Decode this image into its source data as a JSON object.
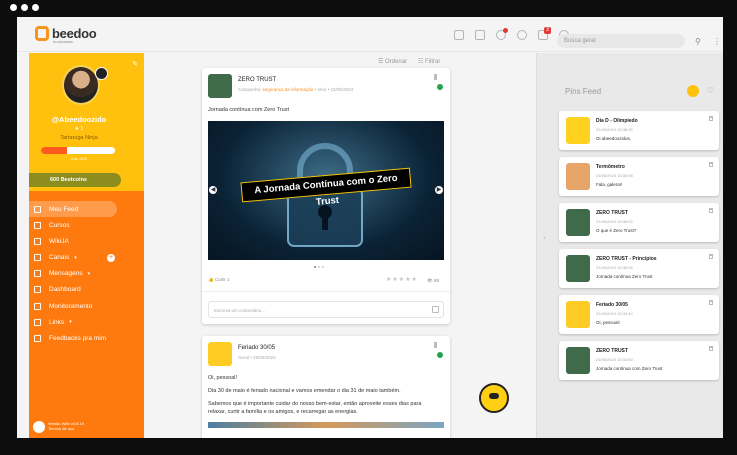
{
  "brand": {
    "name": "beedoo",
    "sub": "PLATAFORMA"
  },
  "topbar": {
    "search_placeholder": "Busca geral",
    "notifications_count": "3"
  },
  "profile": {
    "username": "@Abeedoozido",
    "level": "★ 1",
    "rank": "Tartaruga Ninja",
    "xp_fraction": 0.35,
    "xp_label": "0 de 1000",
    "coins": "600 Beetcoins"
  },
  "nav": [
    {
      "label": "Meu Feed",
      "icon": "feed-icon",
      "active": true
    },
    {
      "label": "Cursos",
      "icon": "courses-icon"
    },
    {
      "label": "WikiJA",
      "icon": "wiki-icon"
    },
    {
      "label": "Canais",
      "icon": "channels-icon",
      "caret": "▾",
      "plus": "+"
    },
    {
      "label": "Mensagens",
      "icon": "messages-icon",
      "caret": "▾"
    },
    {
      "label": "Dashboard",
      "icon": "dashboard-icon"
    },
    {
      "label": "Monitoramento",
      "icon": "monitor-icon"
    },
    {
      "label": "Links",
      "icon": "links-icon",
      "caret": "▾"
    },
    {
      "label": "Feedbacks pra mim",
      "icon": "feedback-icon"
    }
  ],
  "sidebar_footer": {
    "line1": "Versão Web v4.8.19",
    "line2": "Termos de uso"
  },
  "feed_actions": {
    "order": "Ordenar",
    "filter": "Filtrar"
  },
  "posts": [
    {
      "title": "ZERO TRUST",
      "meta_prefix": "Campanha:",
      "meta_channel": "segurança da informação",
      "meta_suffix": " • Vitor • 22/05/2024",
      "text": "Jornada contínua com Zero Trust",
      "banner_text": "A Jornada Contínua com o Zero Trust",
      "reactions": "Curtir 1",
      "stars": "★★★★★",
      "views": "89",
      "comment_placeholder": "Escreva um comentário..."
    },
    {
      "title": "Feriado 30/05",
      "meta": "Geral • 29/05/2024",
      "lines": [
        "Oi, pessoal!",
        "Dia 30 de maio é feriado nacional e vamos emendar o dia 31 de maio também.",
        "Sabemos que é importante cuidar do nosso bem-estar, então aproveite esses dias para",
        "relaxar, curtir a família e os amigos, e recarregar as energias."
      ]
    }
  ],
  "pins": {
    "title": "Pins Feed",
    "items": [
      {
        "title": "Dia D - Olimpíedo",
        "date": "21/06/2024 15:38:35",
        "body": "Oi abeedoozidos,",
        "thumb_color": "#ffd21f"
      },
      {
        "title": "Termômetro",
        "date": "21/06/2024 15:38:08",
        "body": "Fala, galera!!",
        "thumb_color": "#e7a56a"
      },
      {
        "title": "ZERO TRUST",
        "date": "21/06/2024 15:36:52",
        "body": "O que é Zero Trust?",
        "thumb_color": "#3f6b4a"
      },
      {
        "title": "ZERO TRUST - Princípios",
        "date": "21/06/2024 15:36:06",
        "body": "Jornada contínua Zero Trust",
        "thumb_color": "#3f6b4a"
      },
      {
        "title": "Feriado 30/05",
        "date": "21/06/2024 15:34:40",
        "body": "Oi, pessoal!",
        "thumb_color": "#ffcc26"
      },
      {
        "title": "ZERO TRUST",
        "date": "21/06/2024 15:33:50",
        "body": "Jornada contínua com Zero Trust",
        "thumb_color": "#3f6b4a"
      }
    ]
  }
}
